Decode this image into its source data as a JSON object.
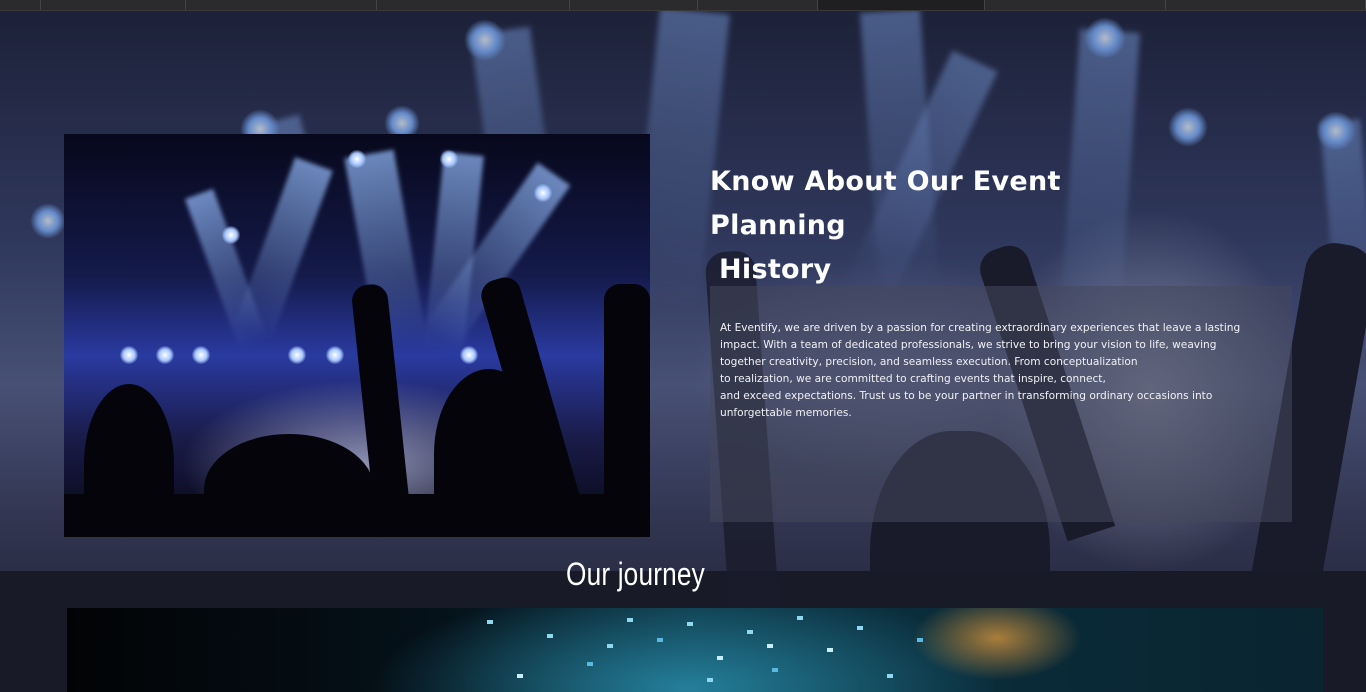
{
  "about": {
    "title_line1": "Know About Our Event Planning",
    "title_line2": "History",
    "text_lines": [
      "At Eventify, we are driven by a passion for creating extraordinary experiences that leave a lasting",
      "impact. With a team of dedicated professionals, we strive to bring your vision to life, weaving",
      "together creativity, precision, and seamless execution. From conceptualization",
      "to realization, we are committed to crafting events that inspire, connect,",
      "and exceed expectations. Trust us to be your partner in transforming ordinary occasions into",
      "unforgettable memories."
    ]
  },
  "journey": {
    "title": "Our journey"
  },
  "images": {
    "background": "concert-crowd-background",
    "feature": "concert-stage-lights-image",
    "journey": "confetti-crowd-image"
  }
}
